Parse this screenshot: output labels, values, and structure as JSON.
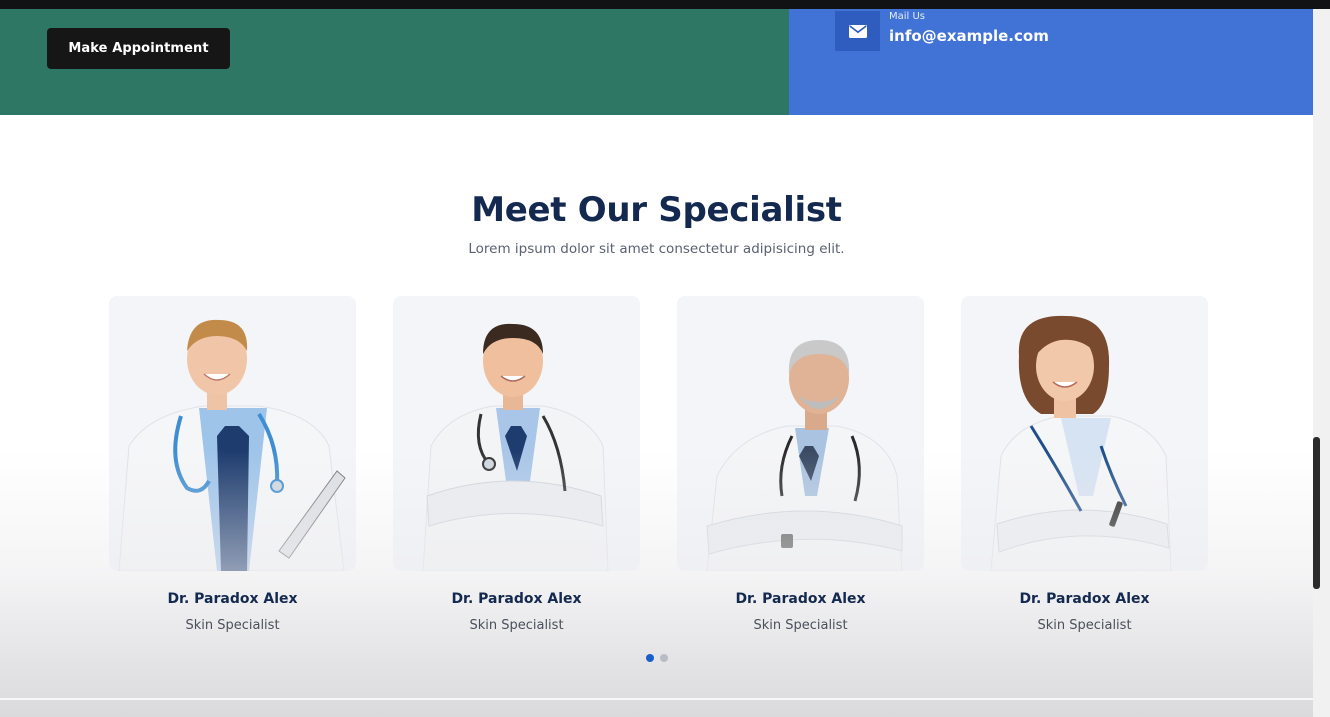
{
  "header": {
    "appointment_button": "Make Appointment",
    "mail": {
      "label": "Mail Us",
      "email": "info@example.com",
      "icon": "envelope-icon"
    }
  },
  "section": {
    "title": "Meet Our Specialist",
    "subtitle": "Lorem ipsum dolor sit amet consectetur adipisicing elit."
  },
  "doctors": [
    {
      "name": "Dr. Paradox Alex",
      "role": "Skin Specialist"
    },
    {
      "name": "Dr. Paradox Alex",
      "role": "Skin Specialist"
    },
    {
      "name": "Dr. Paradox Alex",
      "role": "Skin Specialist"
    },
    {
      "name": "Dr. Paradox Alex",
      "role": "Skin Specialist"
    }
  ],
  "carousel": {
    "pages": 2,
    "active": 1
  },
  "colors": {
    "green_band": "#2f7765",
    "blue_band": "#4172d5",
    "title": "#14294f",
    "dot_active": "#1a5fc8"
  }
}
